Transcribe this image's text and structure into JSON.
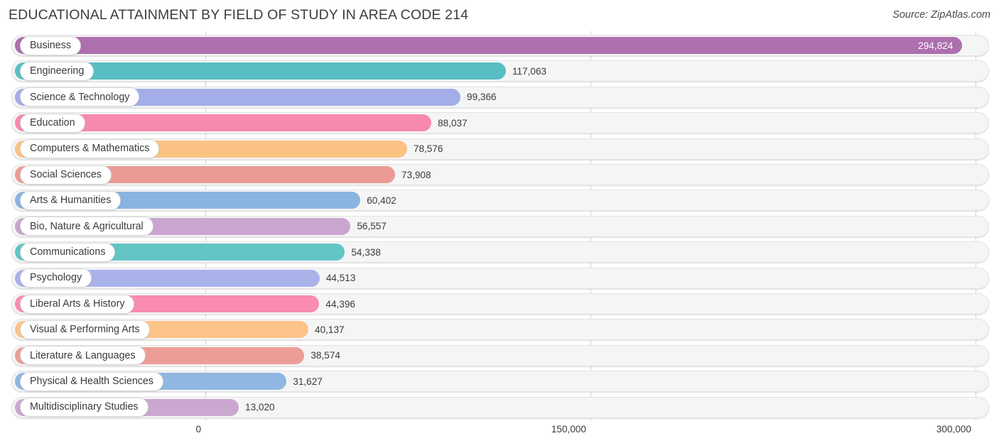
{
  "header": {
    "title": "EDUCATIONAL ATTAINMENT BY FIELD OF STUDY IN AREA CODE 214",
    "source": "Source: ZipAtlas.com"
  },
  "chart_data": {
    "type": "bar",
    "orientation": "horizontal",
    "title": "EDUCATIONAL ATTAINMENT BY FIELD OF STUDY IN AREA CODE 214",
    "subtitle": "",
    "xlabel": "",
    "ylabel": "",
    "xlim": [
      0,
      300000
    ],
    "grid": true,
    "legend": false,
    "xticks": [
      {
        "label": "0",
        "value": 0
      },
      {
        "label": "150,000",
        "value": 150000
      },
      {
        "label": "300,000",
        "value": 300000
      }
    ],
    "categories": [
      "Business",
      "Engineering",
      "Science & Technology",
      "Education",
      "Computers & Mathematics",
      "Social Sciences",
      "Arts & Humanities",
      "Bio, Nature & Agricultural",
      "Communications",
      "Psychology",
      "Liberal Arts & History",
      "Visual & Performing Arts",
      "Literature & Languages",
      "Physical & Health Sciences",
      "Multidisciplinary Studies"
    ],
    "values": [
      294824,
      117063,
      99366,
      88037,
      78576,
      73908,
      60402,
      56557,
      54338,
      44513,
      44396,
      40137,
      38574,
      31627,
      13020
    ],
    "value_labels": [
      "294,824",
      "117,063",
      "99,366",
      "88,037",
      "78,576",
      "73,908",
      "60,402",
      "56,557",
      "54,338",
      "44,513",
      "44,396",
      "40,137",
      "38,574",
      "31,627",
      "13,020"
    ],
    "colors": [
      "#ad6fad",
      "#57bfc3",
      "#a3aee8",
      "#f889ae",
      "#fbc383",
      "#eb9b94",
      "#8ab4e0",
      "#c9a6cf",
      "#63c4c6",
      "#a9b3ea",
      "#f98cb0",
      "#fcc488",
      "#ec9d96",
      "#8fb7e2",
      "#caa8d0"
    ]
  }
}
